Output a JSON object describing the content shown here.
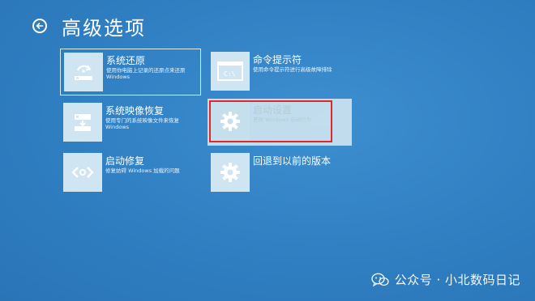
{
  "header": {
    "back_icon": "back-arrow-circle-icon",
    "title": "高级选项"
  },
  "tiles": [
    {
      "title": "系统还原",
      "desc": "使用你电脑上记录的还原点来还原 Windows",
      "icon": "restore-icon"
    },
    {
      "title": "系统映像恢复",
      "desc": "使用专门的系统映像文件来恢复 Windows",
      "icon": "system-image-icon"
    },
    {
      "title": "启动修复",
      "desc": "修复妨碍 Windows 加载的问题",
      "icon": "code-brackets-icon"
    },
    {
      "title": "命令提示符",
      "desc": "使用命令提示符进行高级故障排除",
      "icon": "terminal-icon",
      "icon_text": "C:\\"
    },
    {
      "title": "启动设置",
      "desc": "更改 Windows 启动行为",
      "icon": "gear-icon"
    },
    {
      "title": "回退到以前的版本",
      "desc": "",
      "icon": "gear-icon"
    }
  ],
  "watermark": {
    "text": "公众号 · 小北数码日记",
    "icon": "wechat-icon"
  },
  "colors": {
    "background": "#2f7fc2",
    "tile_icon_bg": "#cfe6f2",
    "highlight_border": "#e0282a",
    "text": "#ffffff"
  }
}
